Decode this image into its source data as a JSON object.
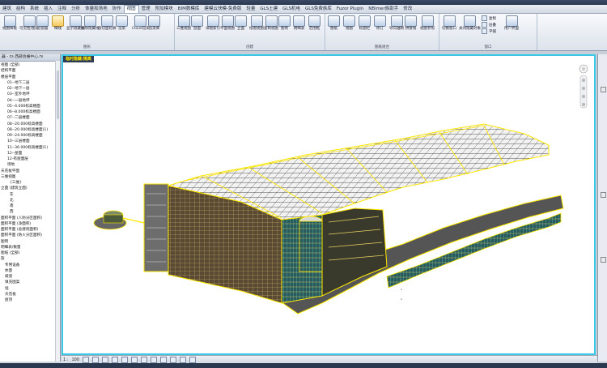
{
  "menubar": {
    "items": [
      "建筑",
      "结构",
      "系统",
      "插入",
      "注释",
      "分析",
      "体量和场地",
      "协作",
      "视图",
      "管理",
      "附加模块",
      "BIM数模库",
      "建模云快模-免费版",
      "轻量",
      "GLS土建",
      "GLS机电",
      "GLS免费族库",
      "Fuzor Plugin",
      "NBimer族助手",
      "修改"
    ],
    "active_index": 8
  },
  "ribbon": {
    "groups": [
      {
        "label": "图形",
        "buttons": [
          "视图样板",
          "可见性/图形",
          "过滤器",
          "细线",
          "显示隐藏线",
          "删除隐藏线",
          "剖切面轮廓",
          "渲染",
          "Cloud渲染",
          "渲染库"
        ]
      },
      {
        "label": "创建",
        "buttons": [
          "三维视图",
          "剖面",
          "详图索引",
          "平面视图",
          "立面",
          "绘图视图",
          "复制视图",
          "图例",
          "明细表",
          "范围框"
        ]
      },
      {
        "label": "图纸组合",
        "buttons": [
          "图纸",
          "视图",
          "标题栏",
          "修订",
          "导向轴网",
          "拼接线",
          "视图参照"
        ]
      },
      {
        "label": "窗口",
        "buttons": [
          "切换窗口",
          "关闭隐藏对象",
          "复制",
          "层叠",
          "平铺",
          "用户界面"
        ]
      }
    ]
  },
  "project_browser": {
    "title": "器 - cs 西部会展中心.rv",
    "items": [
      {
        "text": "视图 (全部)",
        "level": 0
      },
      {
        "text": "结构平面",
        "level": 0
      },
      {
        "text": "楼层平面",
        "level": 0
      },
      {
        "text": "01--地下二层",
        "level": 2
      },
      {
        "text": "02--地下一层",
        "level": 2
      },
      {
        "text": "03--室外地坪",
        "level": 2
      },
      {
        "text": "04--一层地坪",
        "level": 2
      },
      {
        "text": "05--4.000标高楼面",
        "level": 2
      },
      {
        "text": "06--8.000标高楼面",
        "level": 2
      },
      {
        "text": "07--二层楼面",
        "level": 2
      },
      {
        "text": "08--20.000标高楼面",
        "level": 2
      },
      {
        "text": "08--20.000标高楼面(1)",
        "level": 2
      },
      {
        "text": "09--24.000标高楼面",
        "level": 2
      },
      {
        "text": "10--三层楼面",
        "level": 2
      },
      {
        "text": "11--36.000标高楼面(1)",
        "level": 2
      },
      {
        "text": "12--屋面",
        "level": 2
      },
      {
        "text": "12-有屋面层",
        "level": 2
      },
      {
        "text": "场地",
        "level": 2
      },
      {
        "text": "天花板平面",
        "level": 0
      },
      {
        "text": "三维视图",
        "level": 0
      },
      {
        "text": "{三维}",
        "level": 3
      },
      {
        "text": "立面 (建筑立面)",
        "level": 0
      },
      {
        "text": "东",
        "level": 3
      },
      {
        "text": "北",
        "level": 3
      },
      {
        "text": "南",
        "level": 3
      },
      {
        "text": "西",
        "level": 3
      },
      {
        "text": "面积平面 (人防分区面积)",
        "level": 0
      },
      {
        "text": "面积平面 (净面积)",
        "level": 0
      },
      {
        "text": "面积平面 (总建筑面积)",
        "level": 0
      },
      {
        "text": "面积平面 (防火分区面积)",
        "level": 0
      },
      {
        "text": "图例",
        "level": 0
      },
      {
        "text": "明细表/数量",
        "level": 0
      },
      {
        "text": "图纸 (全部)",
        "level": 0
      },
      {
        "text": "族",
        "level": 0
      },
      {
        "text": "专用设备",
        "level": 1
      },
      {
        "text": "体量",
        "level": 1
      },
      {
        "text": "坡道",
        "level": 1
      },
      {
        "text": "填充图案",
        "level": 1
      },
      {
        "text": "墙",
        "level": 1
      },
      {
        "text": "天花板",
        "level": 1
      },
      {
        "text": "屋顶",
        "level": 1
      }
    ]
  },
  "viewport": {
    "tab_label": "临时隐藏/隔离",
    "border_color": "#38c8e8",
    "tab_text_color": "#ffe800"
  },
  "statusbar": {
    "scale_prefix": "1 :",
    "scale_value": "100"
  },
  "colors": {
    "selection_highlight": "#ffe800",
    "ribbon_bg": "#dde3ec",
    "titlebar": "#2a3850"
  }
}
